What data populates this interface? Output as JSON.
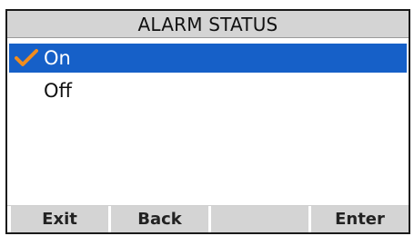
{
  "screen": {
    "title": "ALARM STATUS"
  },
  "menu": {
    "items": [
      {
        "label": "On",
        "selected": true,
        "checked": true
      },
      {
        "label": "Off",
        "selected": false,
        "checked": false
      }
    ],
    "check_icon": "checkmark-icon",
    "check_color": "#f08c1e",
    "highlight_color": "#1660c8"
  },
  "softkeys": [
    {
      "label": "Exit"
    },
    {
      "label": "Back"
    },
    {
      "label": ""
    },
    {
      "label": "Enter"
    }
  ]
}
